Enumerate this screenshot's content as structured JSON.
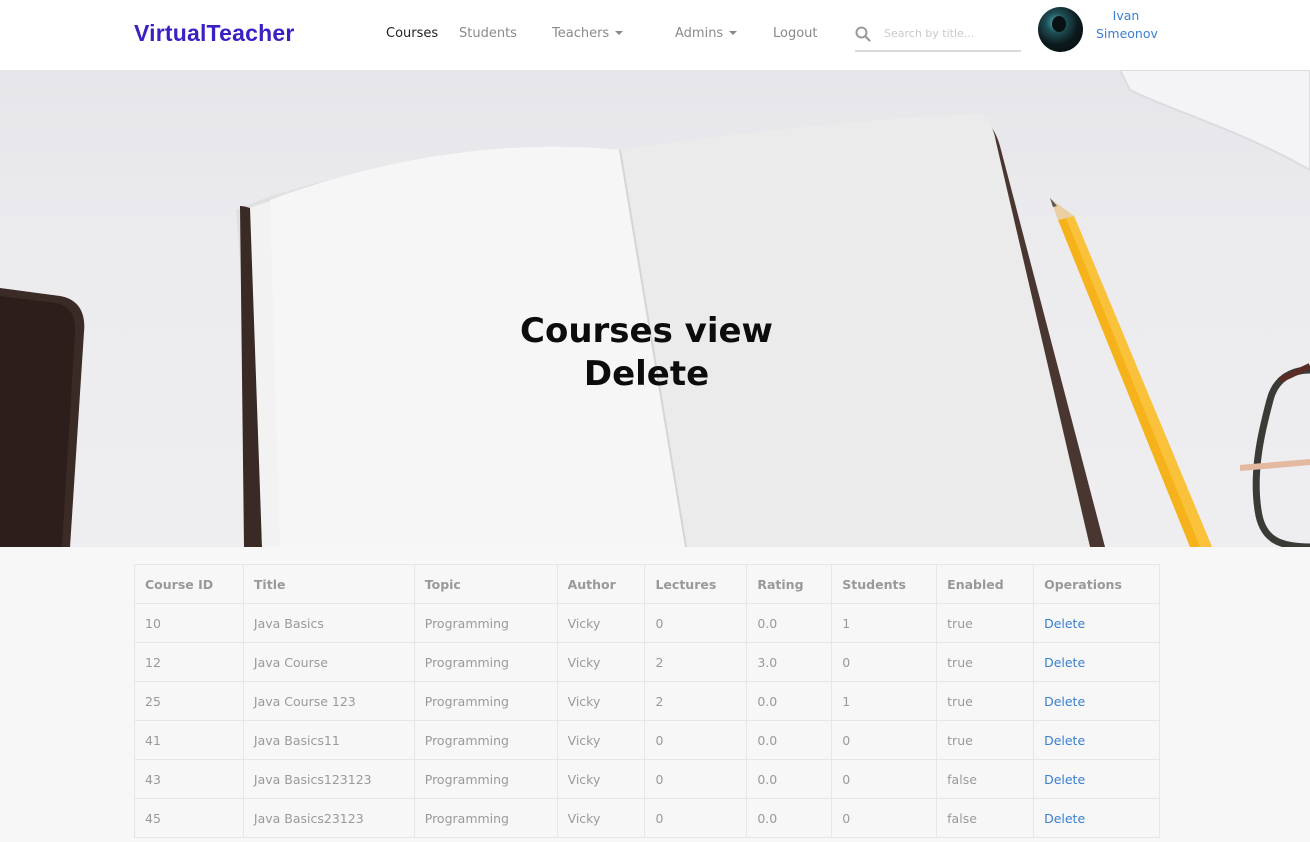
{
  "navbar": {
    "brand": "VirtualTeacher",
    "links": {
      "courses": "Courses",
      "students": "Students",
      "teachers": "Teachers",
      "admins": "Admins",
      "logout": "Logout"
    },
    "search": {
      "placeholder": "Search by title..."
    },
    "user": {
      "first_name": "Ivan",
      "last_name": "Simeonov"
    }
  },
  "hero": {
    "line1": "Courses view",
    "line2": "Delete"
  },
  "table": {
    "headers": [
      "Course ID",
      "Title",
      "Topic",
      "Author",
      "Lectures",
      "Rating",
      "Students",
      "Enabled",
      "Operations"
    ],
    "rows": [
      [
        "10",
        "Java Basics",
        "Programming",
        "Vicky",
        "0",
        "0.0",
        "1",
        "true",
        "Delete"
      ],
      [
        "12",
        "Java Course",
        "Programming",
        "Vicky",
        "2",
        "3.0",
        "0",
        "true",
        "Delete"
      ],
      [
        "25",
        "Java Course 123",
        "Programming",
        "Vicky",
        "2",
        "0.0",
        "1",
        "true",
        "Delete"
      ],
      [
        "41",
        "Java Basics11",
        "Programming",
        "Vicky",
        "0",
        "0.0",
        "0",
        "true",
        "Delete"
      ],
      [
        "43",
        "Java Basics123123",
        "Programming",
        "Vicky",
        "0",
        "0.0",
        "0",
        "false",
        "Delete"
      ],
      [
        "45",
        "Java Basics23123",
        "Programming",
        "Vicky",
        "0",
        "0.0",
        "0",
        "false",
        "Delete"
      ]
    ]
  },
  "colors": {
    "brand": "#3a1fc4",
    "link": "#3a7fd0",
    "page_background": "#f7f7f7"
  },
  "icons": [
    "search-icon",
    "caret-down-icon"
  ]
}
